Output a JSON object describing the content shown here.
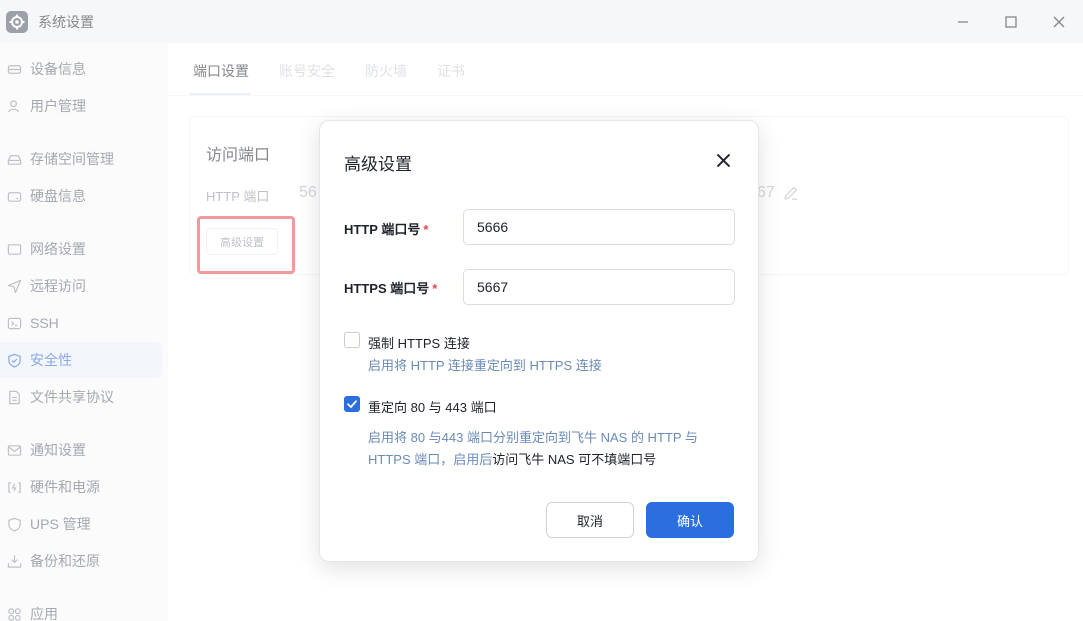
{
  "window": {
    "title": "系统设置",
    "controls": [
      "minimize-icon",
      "maximize-icon",
      "close-icon"
    ]
  },
  "sidebar": {
    "items": [
      {
        "label": "设备信息",
        "icon": "device-icon"
      },
      {
        "label": "用户管理",
        "icon": "user-icon"
      },
      {
        "label": "存储空间管理",
        "icon": "storage-icon"
      },
      {
        "label": "硬盘信息",
        "icon": "disk-icon"
      },
      {
        "label": "网络设置",
        "icon": "network-icon"
      },
      {
        "label": "远程访问",
        "icon": "send-icon"
      },
      {
        "label": "SSH",
        "icon": "terminal-icon"
      },
      {
        "label": "安全性",
        "icon": "shield-icon",
        "active": true
      },
      {
        "label": "文件共享协议",
        "icon": "file-icon"
      },
      {
        "label": "通知设置",
        "icon": "mail-icon"
      },
      {
        "label": "硬件和电源",
        "icon": "hardware-icon"
      },
      {
        "label": "UPS 管理",
        "icon": "ups-shield-icon"
      },
      {
        "label": "备份和还原",
        "icon": "backup-icon"
      },
      {
        "label": "应用",
        "icon": "apps-icon"
      }
    ]
  },
  "tabs": [
    {
      "label": "端口设置",
      "active": true
    },
    {
      "label": "账号安全"
    },
    {
      "label": "防火墙"
    },
    {
      "label": "证书"
    }
  ],
  "card": {
    "title": "访问端口",
    "http_label": "HTTP 端口",
    "http_value_partial": "56",
    "https_value_partial": "67",
    "advanced_button": "高级设置"
  },
  "dialog": {
    "title": "高级设置",
    "http_port_label": "HTTP 端口号",
    "http_port_value": "5666",
    "https_port_label": "HTTPS 端口号",
    "https_port_value": "5667",
    "required_mark": "*",
    "force_https": {
      "label": "强制 HTTPS 连接",
      "checked": false,
      "hint": "启用将 HTTP 连接重定向到 HTTPS 连接"
    },
    "redirect": {
      "label": "重定向 80 与 443 端口",
      "checked": true,
      "hint_part1": "启用将 80 与443 端口分别重定向到飞牛 NAS 的 HTTP 与 HTTPS 端口，启用后",
      "hint_part2": "访问飞牛 NAS 可不填端口号"
    },
    "cancel_label": "取消",
    "confirm_label": "确认"
  },
  "colors": {
    "accent": "#2b6fde",
    "required": "#e5484d",
    "highlight_box": "#e5484d"
  }
}
